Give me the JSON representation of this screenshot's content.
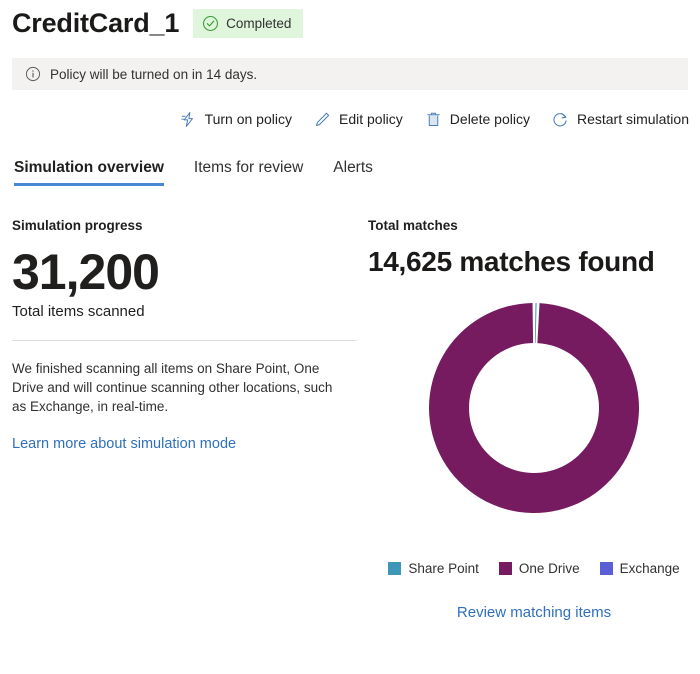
{
  "header": {
    "title": "CreditCard_1",
    "status_badge": {
      "label": "Completed",
      "icon": "check-circle-icon",
      "bg": "#dff6dd",
      "fg": "#107c10"
    }
  },
  "info_bar": {
    "icon": "info-circle-icon",
    "message": "Policy will be turned on in 14 days."
  },
  "command_bar": {
    "items": [
      {
        "label": "Turn on policy",
        "icon": "lightning-bolt-icon"
      },
      {
        "label": "Edit policy",
        "icon": "pencil-icon"
      },
      {
        "label": "Delete policy",
        "icon": "trash-icon"
      },
      {
        "label": "Restart simulation",
        "icon": "refresh-icon"
      }
    ]
  },
  "tabs": [
    {
      "label": "Simulation overview",
      "active": true
    },
    {
      "label": "Items for review",
      "active": false
    },
    {
      "label": "Alerts",
      "active": false
    }
  ],
  "left_panel": {
    "section_label": "Simulation progress",
    "big_number": "31,200",
    "big_number_caption": "Total items scanned",
    "description": "We finished scanning all items on Share Point, One Drive and will continue scanning other locations, such as Exchange, in real-time.",
    "link_label": "Learn more about simulation mode"
  },
  "right_panel": {
    "section_label": "Total matches",
    "headline": "14,625 matches found",
    "review_link_label": "Review matching items"
  },
  "chart_data": {
    "type": "pie",
    "title": "14,625 matches found",
    "subtitle": "Total matches",
    "donut": true,
    "total": 14625,
    "total_label": "matches found",
    "legend_position": "bottom",
    "categories": [
      "Share Point",
      "One Drive",
      "Exchange"
    ],
    "values": [
      90,
      14535,
      0
    ],
    "percentages": [
      0.6,
      99.4,
      0.0
    ],
    "colors": [
      "#3f96b8",
      "#761b60",
      "#5b5fd6"
    ],
    "series": [
      {
        "name": "Share Point",
        "value": 90,
        "percent": 0.6,
        "color": "#3f96b8"
      },
      {
        "name": "One Drive",
        "value": 14535,
        "percent": 99.4,
        "color": "#761b60"
      },
      {
        "name": "Exchange",
        "value": 0,
        "percent": 0.0,
        "color": "#5b5fd6"
      }
    ]
  },
  "colors": {
    "accent_link": "#2f6fbd",
    "tab_underline": "#4a87d3",
    "info_bar_bg": "#f3f2f1",
    "icon_blue": "#4a7ebb"
  }
}
